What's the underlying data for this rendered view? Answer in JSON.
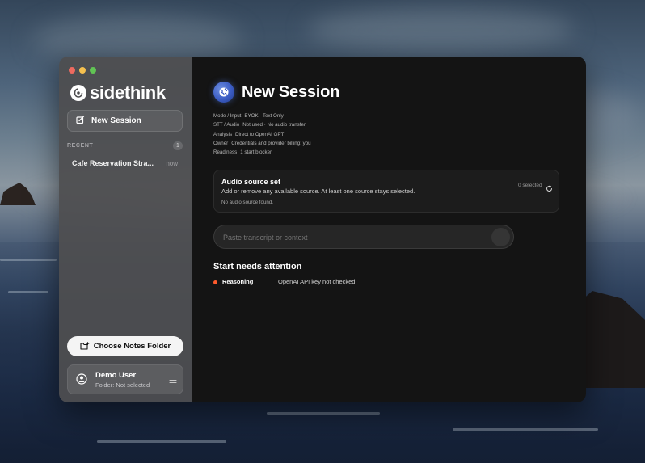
{
  "app": {
    "name": "sidethink"
  },
  "sidebar": {
    "new_session_label": "New Session",
    "recent_label": "RECENT",
    "recent_count": "1",
    "sessions": [
      {
        "title": "Cafe Reservation Stra...",
        "time": "now"
      }
    ],
    "choose_folder_label": "Choose Notes Folder",
    "user": {
      "name": "Demo User",
      "folder": "Folder: Not selected"
    }
  },
  "main": {
    "title": "New Session",
    "meta": [
      {
        "key": "Mode / Input",
        "value": "BYOK · Text Only"
      },
      {
        "key": "STT / Audio",
        "value": "Not used · No audio transfer"
      },
      {
        "key": "Analysis",
        "value": "Direct to OpenAI GPT"
      },
      {
        "key": "Owner",
        "value": "Credentials and provider billing: you"
      },
      {
        "key": "Readiness",
        "value": "1 start blocker"
      }
    ],
    "audio": {
      "title": "Audio source set",
      "description": "Add or remove any available source. At least one source stays selected.",
      "empty": "No audio source found.",
      "selected": "0 selected"
    },
    "transcript": {
      "placeholder": "Paste transcript or context",
      "value": ""
    },
    "attention": {
      "title": "Start needs attention",
      "items": [
        {
          "key": "Reasoning",
          "value": "OpenAI API key not checked",
          "status_color": "#ff5a2c"
        }
      ]
    }
  },
  "colors": {
    "accent_blue": "#3b5cc4",
    "warning": "#ff5a2c",
    "sidebar_bg": "#4e4e50",
    "main_bg": "#141414"
  },
  "icons": {
    "logo": "sidethink-logo-icon",
    "new_session": "compose-icon",
    "choose_folder": "folder-add-icon",
    "avatar": "user-circle-icon",
    "menu": "menu-icon",
    "globe": "globe-icon",
    "refresh": "refresh-icon"
  }
}
